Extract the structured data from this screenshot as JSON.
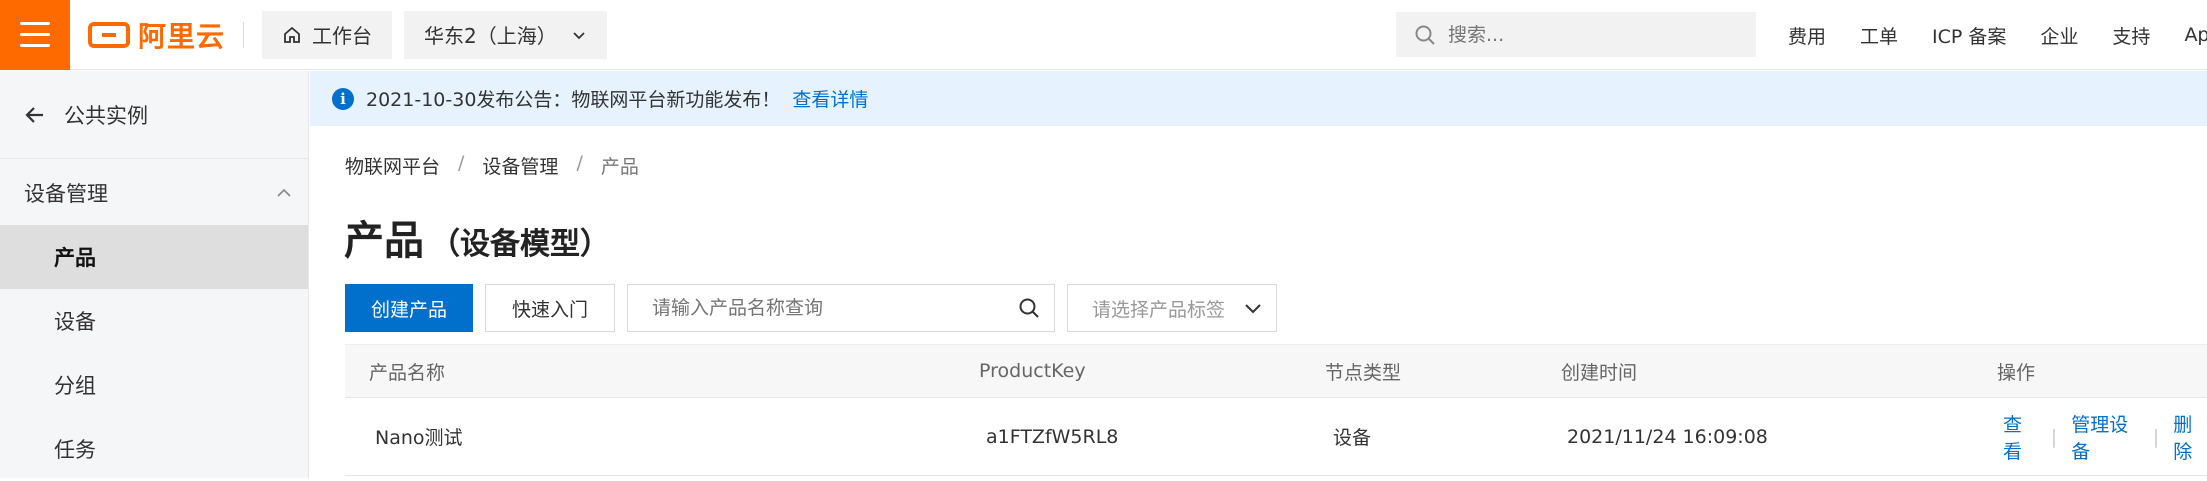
{
  "topbar": {
    "logo_text": "阿里云",
    "workbench_label": "工作台",
    "region_label": "华东2（上海）",
    "search_placeholder": "搜索...",
    "links": [
      "费用",
      "工单",
      "ICP 备案",
      "企业",
      "支持",
      "App"
    ]
  },
  "sidebar": {
    "back_label": "公共实例",
    "group_label": "设备管理",
    "items": [
      {
        "label": "产品",
        "active": true
      },
      {
        "label": "设备",
        "active": false
      },
      {
        "label": "分组",
        "active": false
      },
      {
        "label": "任务",
        "active": false
      }
    ]
  },
  "notice": {
    "text": "2021-10-30发布公告：物联网平台新功能发布！",
    "link": "查看详情"
  },
  "breadcrumb": [
    "物联网平台",
    "设备管理",
    "产品"
  ],
  "page": {
    "title": "产品",
    "subtitle": "（设备模型）"
  },
  "toolbar": {
    "create_label": "创建产品",
    "quickstart_label": "快速入门",
    "search_placeholder": "请输入产品名称查询",
    "tag_placeholder": "请选择产品标签"
  },
  "table": {
    "columns": [
      "产品名称",
      "ProductKey",
      "节点类型",
      "创建时间",
      "操作"
    ],
    "rows": [
      {
        "name": "Nano测试",
        "product_key": "a1FTZfW5RL8",
        "node_type": "设备",
        "created": "2021/11/24 16:09:08",
        "actions": [
          "查看",
          "管理设备",
          "删除"
        ]
      }
    ]
  },
  "colors": {
    "brand": "#ff6a00",
    "primary": "#0070cc",
    "notice_bg": "#e6f3ff"
  }
}
